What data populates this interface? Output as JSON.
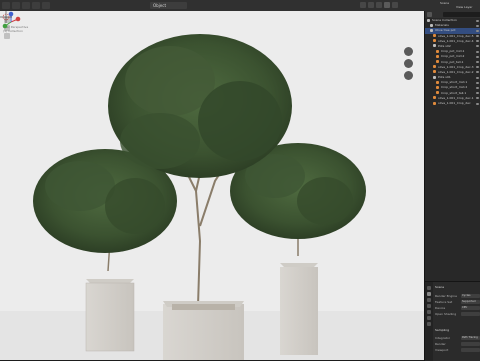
{
  "header": {
    "view_mode": "Object",
    "scene_name": "Scene",
    "view_layer": "View Layer"
  },
  "viewport": {
    "info_line1": "User Perspective",
    "info_line2": "(1) Collection"
  },
  "outliner": {
    "search_placeholder": "",
    "rows": [
      {
        "label": "Scene Collection",
        "depth": 0,
        "icon": "collection",
        "selected": false
      },
      {
        "label": "Materials",
        "depth": 1,
        "icon": "collection",
        "selected": false
      },
      {
        "label": "Olive tree pot",
        "depth": 1,
        "icon": "collection",
        "selected": true
      },
      {
        "label": "olive_1.001_Crop_dec.5",
        "depth": 2,
        "icon": "mesh",
        "selected": false
      },
      {
        "label": "olive_1.001_Crop_dec.4",
        "depth": 2,
        "icon": "mesh",
        "selected": false
      },
      {
        "label": "Pots v02",
        "depth": 2,
        "icon": "collection",
        "selected": false
      },
      {
        "label": "Crop_pot_mid.1",
        "depth": 3,
        "icon": "mesh",
        "selected": false
      },
      {
        "label": "Crop_pot_mid.2",
        "depth": 3,
        "icon": "mesh",
        "selected": false
      },
      {
        "label": "Crop_pot_tall.1",
        "depth": 3,
        "icon": "mesh",
        "selected": false
      },
      {
        "label": "olive_1.001_Crop_dec.3",
        "depth": 2,
        "icon": "mesh",
        "selected": false
      },
      {
        "label": "olive_1.001_Crop_dec.2",
        "depth": 2,
        "icon": "mesh",
        "selected": false
      },
      {
        "label": "Pots v01",
        "depth": 2,
        "icon": "collection",
        "selected": false
      },
      {
        "label": "Crop_short_mid.1",
        "depth": 3,
        "icon": "mesh",
        "selected": false
      },
      {
        "label": "Crop_short_mid.2",
        "depth": 3,
        "icon": "mesh",
        "selected": false
      },
      {
        "label": "Crop_short_tall.1",
        "depth": 3,
        "icon": "mesh",
        "selected": false
      },
      {
        "label": "olive_1.001_Crop_dec.1",
        "depth": 2,
        "icon": "mesh",
        "selected": false
      },
      {
        "label": "olive_1.001_Crop_dec",
        "depth": 2,
        "icon": "mesh",
        "selected": false
      }
    ]
  },
  "properties": {
    "section": "Scene",
    "rows": [
      {
        "label": "Render Engine",
        "value": "Cycles"
      },
      {
        "label": "Feature Set",
        "value": "Supported"
      },
      {
        "label": "Device",
        "value": "CPU"
      },
      {
        "label": "Open Shading",
        "value": ""
      }
    ],
    "subsection": "Sampling",
    "rows2": [
      {
        "label": "Integrator",
        "value": "Path Tracing"
      },
      {
        "label": "Render",
        "value": ""
      },
      {
        "label": "Viewport",
        "value": ""
      }
    ]
  },
  "colors": {
    "accent_selected": "#334d80",
    "viewport_bg": "#ececec",
    "panel_bg": "#282828"
  }
}
